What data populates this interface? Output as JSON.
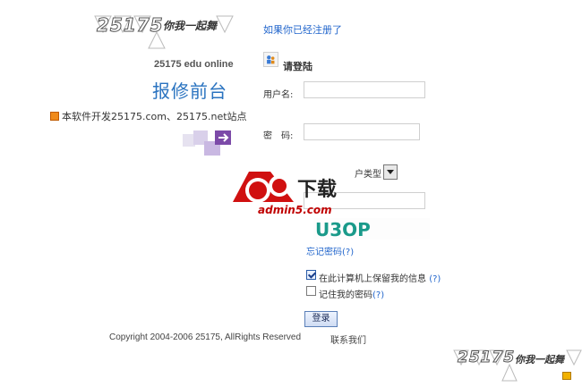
{
  "brand": {
    "logo_number": "25175",
    "logo_slogan": "你我一起舞",
    "edu_online": "25175 edu online",
    "app_title": "报修前台"
  },
  "notice": {
    "text": "本软件开发25175.com、25175.net站点"
  },
  "header": {
    "registered_link": "如果你已经注册了"
  },
  "login": {
    "heading": "请登陆",
    "username_label": "用户名:",
    "username_value": "",
    "password_label": "密　码:",
    "password_value": "",
    "user_type_selected": "户类型",
    "captcha_value": "",
    "captcha_image_text": "U3OP",
    "forgot_password": "忘记密码",
    "help_mark": "(?)",
    "remember_info_label": "在此计算机上保留我的信息",
    "remember_info_checked": true,
    "remember_password_label": "记住我的密码",
    "remember_password_checked": false,
    "submit_label": "登录"
  },
  "watermark": {
    "brand": "a5",
    "download_text": "下载",
    "site": "admin5.com"
  },
  "footer": {
    "copyright": "Copyright 2004-2006 25175, AllRights Reserved",
    "contact": "联系我们"
  },
  "colors": {
    "link": "#2266cc",
    "title_blue": "#2a73c0",
    "watermark_red": "#c00000"
  }
}
